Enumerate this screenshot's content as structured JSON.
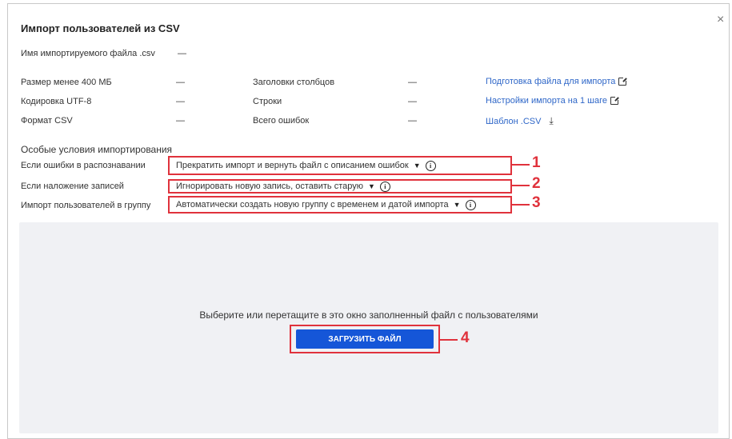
{
  "dialog": {
    "title": "Импорт пользователей из CSV",
    "close_label": "×"
  },
  "file": {
    "name_label": "Имя импортируемого файла .csv",
    "name_value": "—"
  },
  "requirements": [
    {
      "label": "Размер менее 400 МБ",
      "value": "—"
    },
    {
      "label": "Кодировка UTF-8",
      "value": "—"
    },
    {
      "label": "Формат CSV",
      "value": "—"
    }
  ],
  "stats": [
    {
      "label": "Заголовки столбцов",
      "value": "—"
    },
    {
      "label": "Строки",
      "value": "—"
    },
    {
      "label": "Всего ошибок",
      "value": "—"
    }
  ],
  "links": [
    {
      "label": "Подготовка файла для импорта",
      "icon": "external-link-icon"
    },
    {
      "label": "Настройки импорта на 1 шаге",
      "icon": "external-link-icon"
    },
    {
      "label": "Шаблон .CSV",
      "icon": "download-icon"
    }
  ],
  "conditions": {
    "title": "Особые условия импортирования",
    "rows": [
      {
        "label": "Если ошибки в распознавании",
        "value": "Прекратить импорт и вернуть файл с описанием ошибок",
        "marker": "1"
      },
      {
        "label": "Если наложение записей",
        "value": "Игнорировать новую запись, оставить старую",
        "marker": "2"
      },
      {
        "label": "Импорт пользователей в группу",
        "value": "Автоматически создать новую группу с временем и датой импорта",
        "marker": "3"
      }
    ]
  },
  "dropzone": {
    "text": "Выберите или перетащите в это окно заполненный файл с пользователями",
    "button_label": "ЗАГРУЗИТЬ ФАЙЛ",
    "marker": "4"
  },
  "colors": {
    "accent": "#1556d8",
    "link": "#2f67c8",
    "highlight": "#e0323c",
    "dropzone_bg": "#f0f1f4"
  }
}
